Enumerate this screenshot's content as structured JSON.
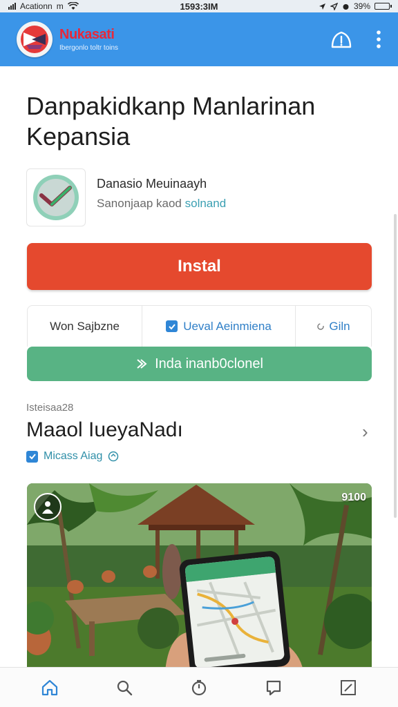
{
  "status_bar": {
    "carrier": "Acationn",
    "carrier_suffix": "m",
    "time": "1593:3IM",
    "battery": "39%"
  },
  "header": {
    "brand_name": "Nukasati",
    "tagline": "Ibergonlo toltr toins",
    "colors": {
      "bar": "#3b95e8",
      "brand": "#e8283a"
    },
    "icons": [
      "alert-icon",
      "more-vertical-icon"
    ]
  },
  "main": {
    "title": "Danpakidkanp Manlarinan Kepansia",
    "app": {
      "name": "Danasio Meuinaayh",
      "subtitle": "Sanonjaap kaod",
      "subtitle_accent": "solnand"
    },
    "install_label": "Instal",
    "options": {
      "opt1": "Won Sajbzne",
      "opt2": "Ueval Aeinmiena",
      "opt3": "Giln"
    },
    "secondary_label": "Inda inanb0clonel",
    "section": {
      "eyebrow": "Isteisaa28",
      "title": "Maaol IueyaNadı",
      "tag": "Micass Aiag"
    },
    "media": {
      "counter": "9100",
      "description": "garden pavilion with phone showing map"
    }
  },
  "bottom_nav": {
    "items": [
      "home-icon",
      "search-icon",
      "timer-icon",
      "chat-icon",
      "edit-icon"
    ]
  }
}
